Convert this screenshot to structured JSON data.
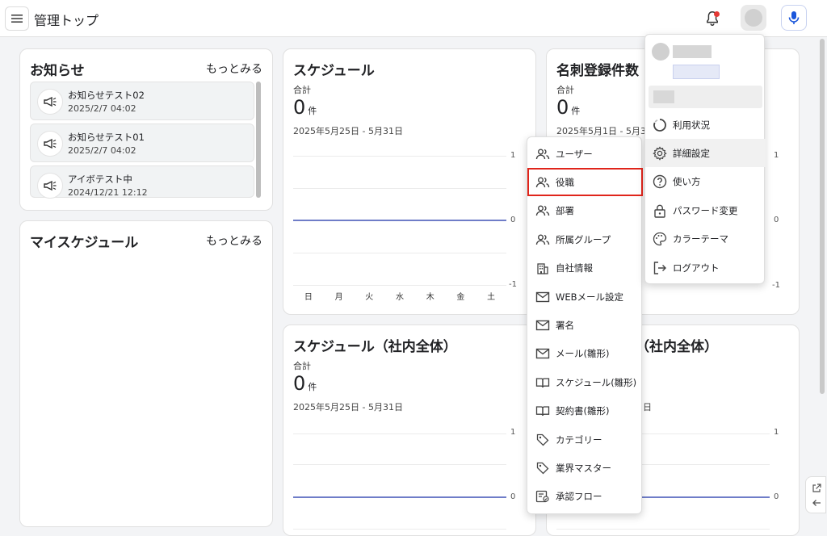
{
  "header": {
    "menu_icon": "hamburger-icon",
    "title": "管理トップ",
    "bell_icon": "bell-icon",
    "mic_icon": "microphone-icon",
    "accent_color": "#1a56db"
  },
  "news": {
    "title": "お知らせ",
    "more": "もっとみる",
    "items": [
      {
        "title": "お知らせテスト02",
        "date": "2025/2/7 04:02"
      },
      {
        "title": "お知らせテスト01",
        "date": "2025/2/7 04:02"
      },
      {
        "title": "アイボテスト中",
        "date": "2024/12/21 12:12"
      }
    ]
  },
  "my_schedule": {
    "title": "マイスケジュール",
    "more": "もっとみる"
  },
  "schedule": {
    "title": "スケジュール",
    "total_label": "合計",
    "value": "0",
    "unit": "件",
    "range": "2025年5月25日 - 5月31日",
    "chart_data": {
      "type": "line",
      "categories": [
        "日",
        "月",
        "火",
        "水",
        "木",
        "金",
        "土"
      ],
      "values": [
        0,
        0,
        0,
        0,
        0,
        0,
        0
      ],
      "ylim": [
        -1,
        1
      ],
      "yticks": [
        "1",
        "0",
        "-1"
      ]
    }
  },
  "cards_registered": {
    "title": "名刺登録件数",
    "total_label": "合計",
    "value": "0",
    "unit": "件",
    "range": "2025年5月1日 - 5月31日",
    "yticks": [
      "1",
      "0",
      "-1"
    ]
  },
  "schedule_company": {
    "title": "スケジュール（社内全体）",
    "total_label": "合計",
    "value": "0",
    "unit": "件",
    "range": "2025年5月25日 - 5月31日",
    "yticks": [
      "1",
      "0"
    ]
  },
  "right_bottom": {
    "title_partial": "（社内全体）",
    "range_partial": "日",
    "yticks": [
      "1",
      "0"
    ]
  },
  "settings_menu": {
    "items": [
      {
        "label": "ユーザー",
        "icon": "users-icon"
      },
      {
        "label": "役職",
        "icon": "users-icon"
      },
      {
        "label": "部署",
        "icon": "users-icon"
      },
      {
        "label": "所属グループ",
        "icon": "users-icon"
      },
      {
        "label": "自社情報",
        "icon": "building-icon"
      },
      {
        "label": "WEBメール設定",
        "icon": "mail-icon"
      },
      {
        "label": "署名",
        "icon": "mail-icon"
      },
      {
        "label": "メール(雛形)",
        "icon": "mail-icon"
      },
      {
        "label": "スケジュール(雛形)",
        "icon": "book-icon"
      },
      {
        "label": "契約書(雛形)",
        "icon": "book-icon"
      },
      {
        "label": "カテゴリー",
        "icon": "tag-icon"
      },
      {
        "label": "業界マスター",
        "icon": "tag-icon"
      },
      {
        "label": "承認フロー",
        "icon": "approval-flow-icon"
      }
    ],
    "highlighted_index": 1,
    "highlight_color": "#e0251b"
  },
  "user_menu": {
    "items": [
      {
        "label": "利用状況",
        "icon": "usage-circle-icon"
      },
      {
        "label": "詳細設定",
        "icon": "gear-icon"
      },
      {
        "label": "使い方",
        "icon": "help-icon"
      },
      {
        "label": "パスワード変更",
        "icon": "lock-icon"
      },
      {
        "label": "カラーテーマ",
        "icon": "palette-icon"
      },
      {
        "label": "ログアウト",
        "icon": "logout-icon"
      }
    ],
    "active_index": 1
  },
  "side_buttons": {
    "open_icon": "external-link-icon",
    "back_icon": "arrow-left-icon"
  }
}
